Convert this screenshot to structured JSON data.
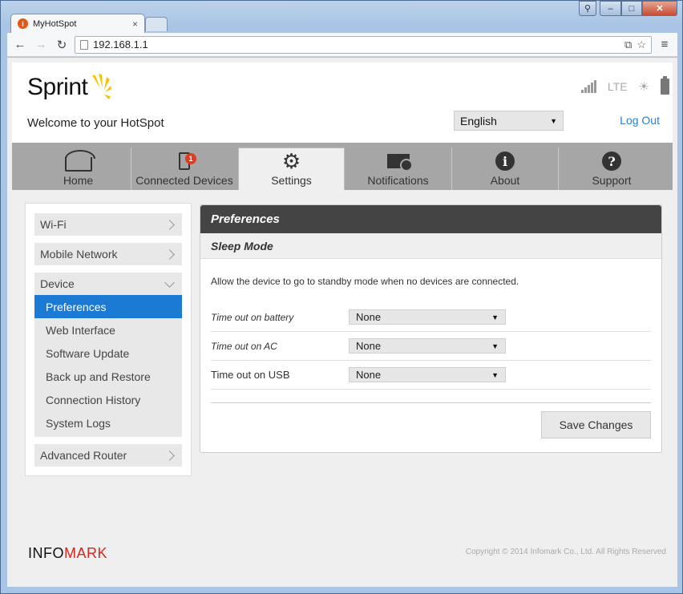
{
  "browser": {
    "tab_title": "MyHotSpot",
    "url": "192.168.1.1",
    "favicon_glyph": "i"
  },
  "header": {
    "logo": "Sprint",
    "welcome": "Welcome to your HotSpot",
    "network_type": "LTE",
    "language": "English",
    "logout": "Log Out"
  },
  "nav": {
    "tabs": [
      {
        "label": "Home",
        "icon": "home-icon"
      },
      {
        "label": "Connected Devices",
        "icon": "phone-icon",
        "badge": "1"
      },
      {
        "label": "Settings",
        "icon": "gear-icon"
      },
      {
        "label": "Notifications",
        "icon": "envelope-icon"
      },
      {
        "label": "About",
        "icon": "info-icon"
      },
      {
        "label": "Support",
        "icon": "help-icon"
      }
    ],
    "active": "Settings"
  },
  "sidebar": {
    "wifi": "Wi-Fi",
    "mobile_network": "Mobile Network",
    "device": "Device",
    "device_items": [
      "Preferences",
      "Web Interface",
      "Software Update",
      "Back up and Restore",
      "Connection History",
      "System Logs"
    ],
    "advanced_router": "Advanced Router"
  },
  "panel": {
    "title": "Preferences",
    "section": "Sleep Mode",
    "description": "Allow the device to go to standby mode when no devices are connected.",
    "fields": [
      {
        "label": "Time out on battery",
        "value": "None"
      },
      {
        "label": "Time out on AC",
        "value": "None"
      },
      {
        "label": "Time out on USB",
        "value": "None"
      }
    ],
    "save": "Save Changes"
  },
  "footer": {
    "brand_a": "INFO",
    "brand_b": "MARK",
    "copyright": "Copyright © 2014 Infomark Co., Ltd. All Rights Reserved"
  },
  "colors": {
    "accent": "#1a7ad4",
    "badge": "#e03b1e",
    "brand_red": "#d9261c",
    "link": "#2a7fd4"
  }
}
